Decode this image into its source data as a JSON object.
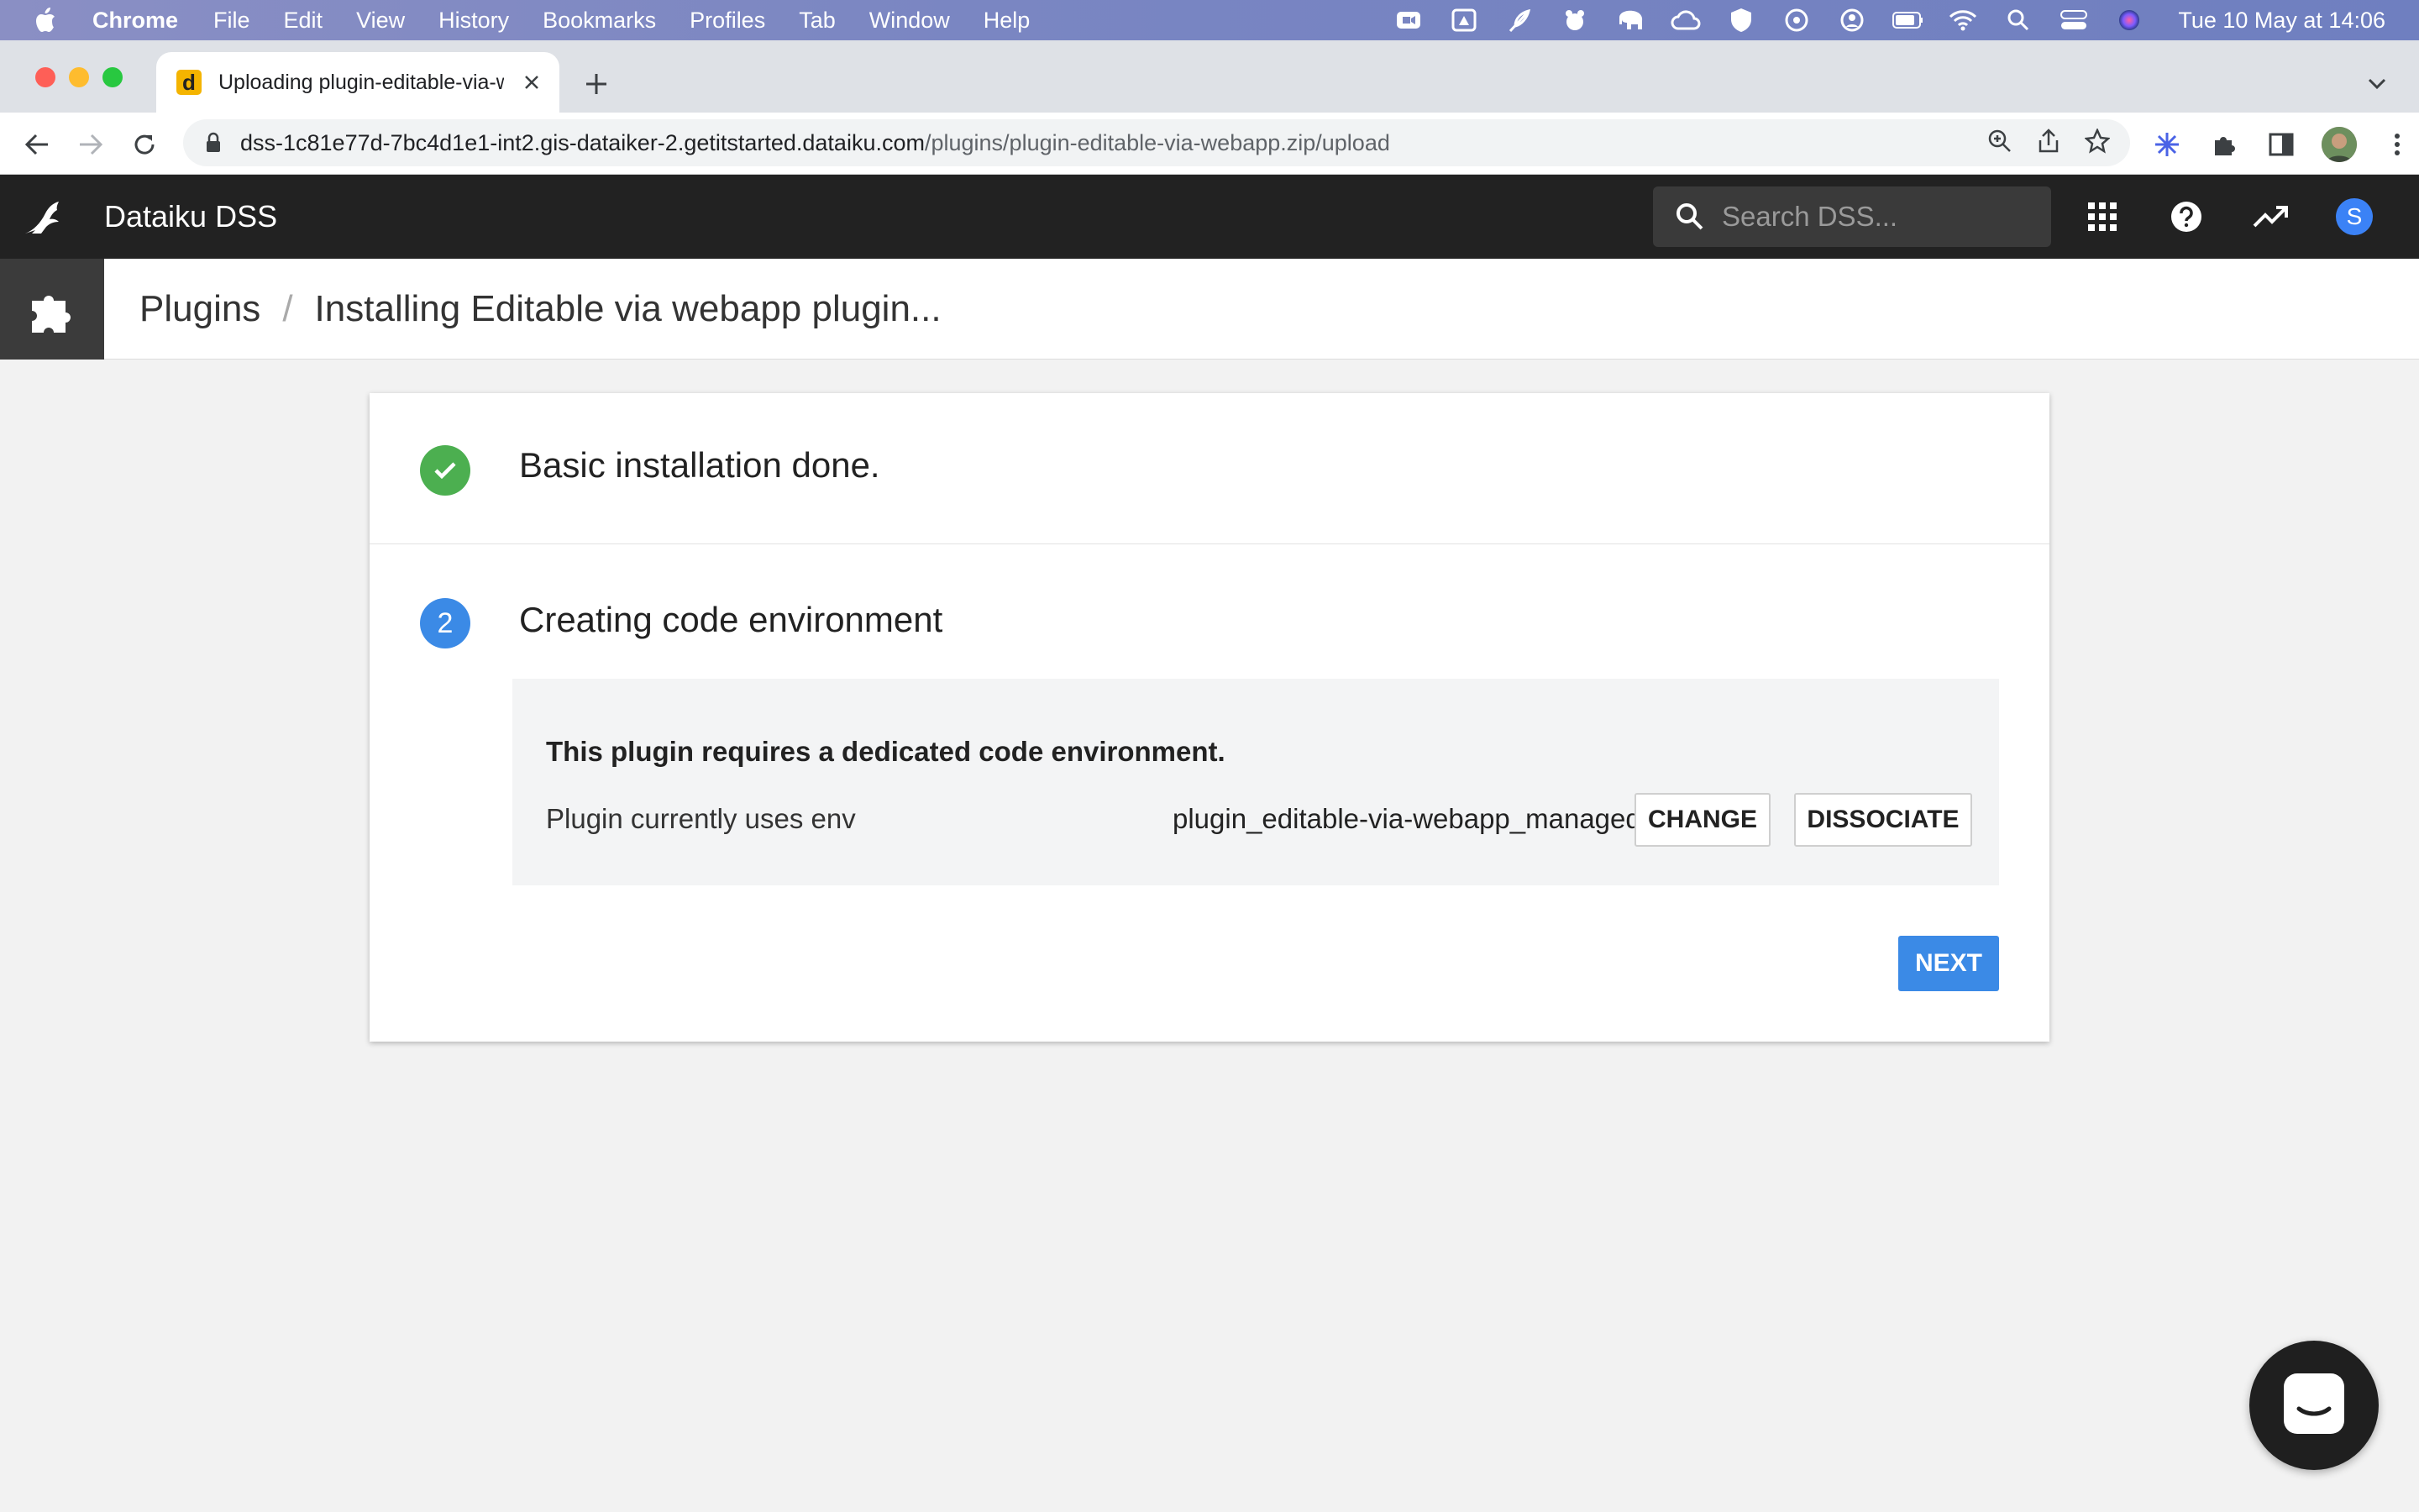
{
  "menubar": {
    "app": "Chrome",
    "items": [
      "File",
      "Edit",
      "View",
      "History",
      "Bookmarks",
      "Profiles",
      "Tab",
      "Window",
      "Help"
    ],
    "clock": "Tue 10 May at  14:06",
    "tray_icons": [
      "zoom-icon",
      "drive-icon",
      "feather-icon",
      "bear-icon",
      "elephant-icon",
      "cloud-icon",
      "shield-icon",
      "vpn-icon",
      "user-circle-icon",
      "battery-icon",
      "wifi-icon",
      "spotlight-icon",
      "control-center-icon",
      "siri-icon"
    ]
  },
  "browser": {
    "tab_title": "Uploading plugin-editable-via-webapp.zip",
    "favicon_letter": "d",
    "url_host": "dss-1c81e77d-7bc4d1e1-int2.gis-dataiker-2.getitstarted.dataiku.com",
    "url_path": "/plugins/plugin-editable-via-webapp.zip/upload"
  },
  "dss": {
    "app_name": "Dataiku DSS",
    "search_placeholder": "Search DSS...",
    "avatar_letter": "S"
  },
  "breadcrumb": {
    "section": "Plugins",
    "separator": "/",
    "current": "Installing Editable via webapp plugin..."
  },
  "install": {
    "step1_label": "Basic installation done.",
    "step2_number": "2",
    "step2_label": "Creating code environment",
    "requirement_text": "This plugin requires a dedicated code environment.",
    "uses_env_label": "Plugin currently uses env",
    "env_name": "plugin_editable-via-webapp_managed",
    "change_label": "CHANGE",
    "dissociate_label": "DISSOCIATE",
    "next_label": "NEXT"
  },
  "colors": {
    "dss_nav_bg": "#222222",
    "success_green": "#4caf50",
    "accent_blue": "#3b8ae6"
  }
}
